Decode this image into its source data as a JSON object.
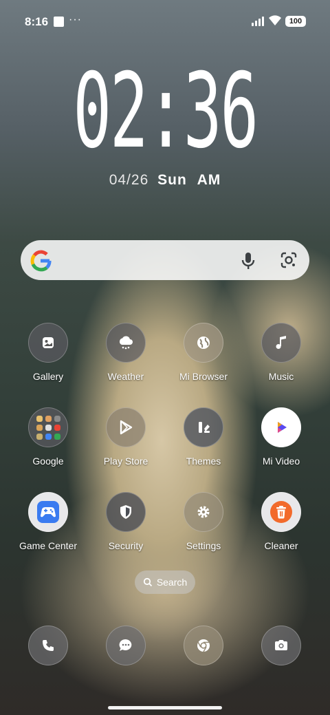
{
  "status_bar": {
    "time": "8:16",
    "more": "···",
    "battery": "100"
  },
  "clock": {
    "time": "02:36",
    "date": "04/26",
    "day": "Sun",
    "ampm": "AM"
  },
  "google_search": {
    "logo_icon": "google-g-icon",
    "mic_icon": "microphone-icon",
    "lens_icon": "google-lens-icon"
  },
  "apps": [
    {
      "label": "Gallery",
      "icon": "gallery-icon"
    },
    {
      "label": "Weather",
      "icon": "weather-icon"
    },
    {
      "label": "Mi Browser",
      "icon": "browser-globe-icon"
    },
    {
      "label": "Music",
      "icon": "music-note-icon"
    },
    {
      "label": "Google",
      "icon": "google-folder-icon"
    },
    {
      "label": "Play Store",
      "icon": "play-store-icon"
    },
    {
      "label": "Themes",
      "icon": "themes-icon"
    },
    {
      "label": "Mi Video",
      "icon": "mi-video-icon"
    },
    {
      "label": "Game Center",
      "icon": "game-controller-icon"
    },
    {
      "label": "Security",
      "icon": "shield-icon"
    },
    {
      "label": "Settings",
      "icon": "gear-icon"
    },
    {
      "label": "Cleaner",
      "icon": "trash-icon"
    }
  ],
  "search_pill": {
    "label": "Search"
  },
  "dock": [
    {
      "icon": "phone-icon"
    },
    {
      "icon": "messages-icon"
    },
    {
      "icon": "chrome-icon"
    },
    {
      "icon": "camera-icon"
    }
  ],
  "colors": {
    "game_center": "#3a7bf0",
    "cleaner": "#f26a2b",
    "mi_video_accent": "#5a4af0"
  }
}
